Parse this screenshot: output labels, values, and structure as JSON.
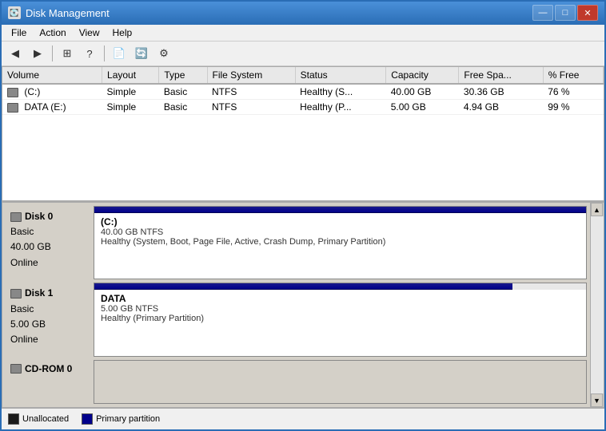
{
  "window": {
    "title": "Disk Management",
    "icon": "💽"
  },
  "title_controls": {
    "minimize": "—",
    "maximize": "□",
    "close": "✕"
  },
  "menu": {
    "items": [
      "File",
      "Action",
      "View",
      "Help"
    ]
  },
  "toolbar": {
    "buttons": [
      "◀",
      "▶",
      "⊞",
      "?",
      "⊡",
      "📋",
      "🖼",
      "⚙"
    ]
  },
  "table": {
    "headers": [
      "Volume",
      "Layout",
      "Type",
      "File System",
      "Status",
      "Capacity",
      "Free Spa...",
      "% Free"
    ],
    "rows": [
      {
        "volume": "(C:)",
        "layout": "Simple",
        "type": "Basic",
        "fs": "NTFS",
        "status": "Healthy (S...",
        "capacity": "40.00 GB",
        "free": "30.36 GB",
        "percent": "76 %"
      },
      {
        "volume": "DATA (E:)",
        "layout": "Simple",
        "type": "Basic",
        "fs": "NTFS",
        "status": "Healthy (P...",
        "capacity": "5.00 GB",
        "free": "4.94 GB",
        "percent": "99 %"
      }
    ]
  },
  "disks": [
    {
      "id": "disk0",
      "label": "Disk 0",
      "type": "Basic",
      "size": "40.00 GB",
      "status": "Online",
      "partition_name": "(C:)",
      "partition_size": "40.00 GB NTFS",
      "partition_status": "Healthy (System, Boot, Page File, Active, Crash Dump, Primary Partition)"
    },
    {
      "id": "disk1",
      "label": "Disk 1",
      "type": "Basic",
      "size": "5.00 GB",
      "status": "Online",
      "partition_name": "DATA",
      "partition_size": "5.00 GB NTFS",
      "partition_status": "Healthy (Primary Partition)"
    }
  ],
  "cd_rom": {
    "label": "CD-ROM 0"
  },
  "legend": [
    {
      "key": "unallocated",
      "label": "Unallocated"
    },
    {
      "key": "primary",
      "label": "Primary partition"
    }
  ]
}
